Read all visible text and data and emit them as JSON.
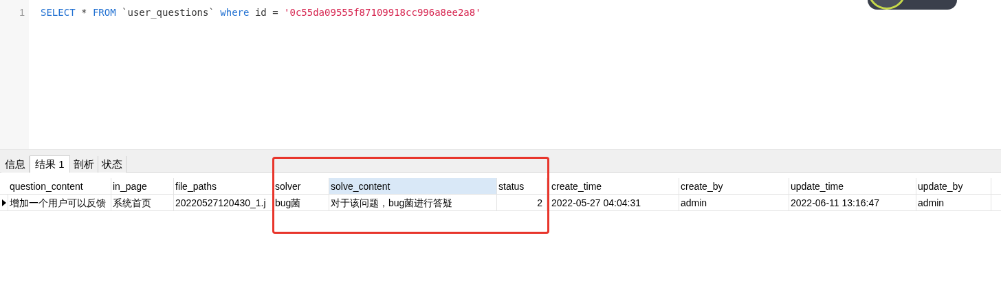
{
  "editor": {
    "lines": [
      {
        "number": "1",
        "tokens": [
          {
            "kind": "keyword",
            "text": "SELECT"
          },
          {
            "kind": "plain",
            "text": " * "
          },
          {
            "kind": "keyword",
            "text": "FROM"
          },
          {
            "kind": "plain",
            "text": " `user_questions` "
          },
          {
            "kind": "keyword",
            "text": "where"
          },
          {
            "kind": "plain",
            "text": " id = "
          },
          {
            "kind": "string",
            "text": "'0c55da09555f87109918cc996a8ee2a8'"
          }
        ]
      }
    ]
  },
  "tabs": [
    {
      "label": "信息",
      "selected": false
    },
    {
      "label": "结果 1",
      "selected": true
    },
    {
      "label": "剖析",
      "selected": false
    },
    {
      "label": "状态",
      "selected": false
    }
  ],
  "table": {
    "columns": [
      {
        "label": "question_content",
        "selected": false
      },
      {
        "label": "in_page",
        "selected": false
      },
      {
        "label": "file_paths",
        "selected": false
      },
      {
        "label": "solver",
        "selected": false
      },
      {
        "label": "solve_content",
        "selected": true
      },
      {
        "label": "status",
        "selected": false
      },
      {
        "label": "create_time",
        "selected": false
      },
      {
        "label": "create_by",
        "selected": false
      },
      {
        "label": "update_time",
        "selected": false
      },
      {
        "label": "update_by",
        "selected": false
      }
    ],
    "rows": [
      {
        "current": true,
        "cells": [
          "增加一个用户可以反馈",
          "系统首页",
          "20220527120430_1.j",
          "bug菌",
          "对于该问题，bug菌进行答疑",
          "2",
          "2022-05-27 04:04:31",
          "admin",
          "2022-06-11 13:16:47",
          "admin"
        ]
      }
    ]
  }
}
